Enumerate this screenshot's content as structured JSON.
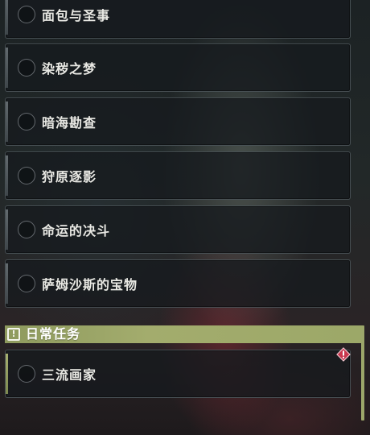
{
  "quests": [
    {
      "title": "面包与圣事"
    },
    {
      "title": "染秽之梦"
    },
    {
      "title": "暗海勘查"
    },
    {
      "title": "狩原逐影"
    },
    {
      "title": "命运的决斗"
    },
    {
      "title": "萨姆沙斯的宝物"
    }
  ],
  "daily_section": {
    "title": "日常任务",
    "icon": "exclamation-box-icon",
    "quests": [
      {
        "title": "三流画家",
        "badge": "alert-diamond-icon"
      }
    ]
  },
  "colors": {
    "section_header": "#9ca868",
    "alert_badge": "#c8374e",
    "text": "#e9e9e4"
  }
}
